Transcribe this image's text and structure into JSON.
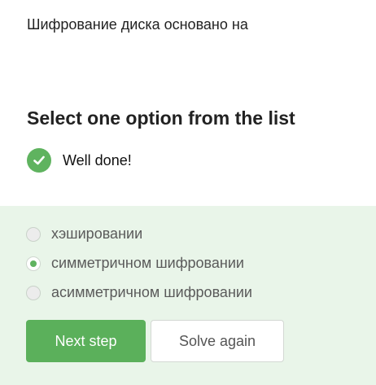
{
  "question": {
    "text": "Шифрование диска основано на"
  },
  "task": {
    "heading": "Select one option from the list"
  },
  "feedback": {
    "text": "Well done!",
    "icon": "check-circle-icon",
    "color": "#5fb35f"
  },
  "options": [
    {
      "label": "хэшировании",
      "selected": false
    },
    {
      "label": "симметричном шифровании",
      "selected": true
    },
    {
      "label": "асимметричном шифровании",
      "selected": false
    }
  ],
  "buttons": {
    "next": "Next step",
    "solve_again": "Solve again"
  },
  "colors": {
    "accent": "#5bb05b",
    "panel_bg": "#e9f5e9"
  }
}
